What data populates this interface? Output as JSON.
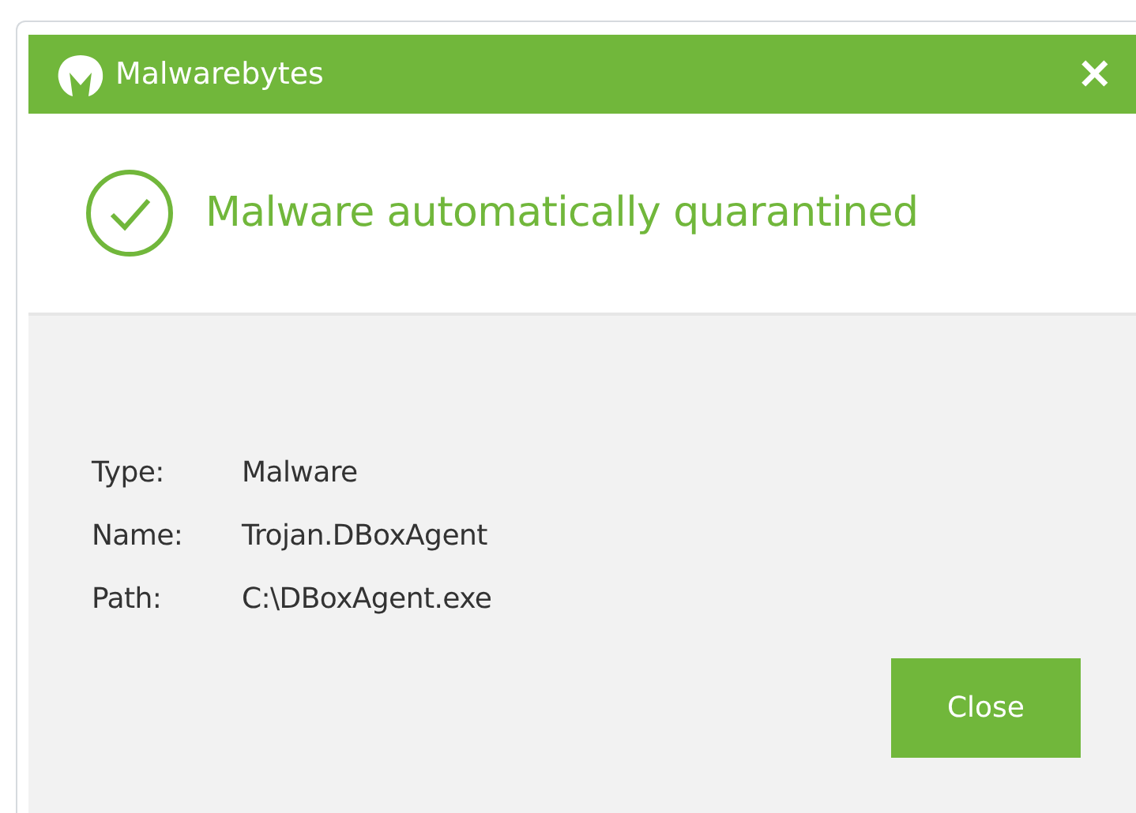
{
  "window": {
    "title": "Malwarebytes",
    "close": "✕"
  },
  "notification": {
    "kind": "success",
    "message": "Malware automatically quarantined"
  },
  "details": [
    {
      "label": "Type:",
      "value": "Malware"
    },
    {
      "label": "Name:",
      "value": "Trojan.DBoxAgent"
    },
    {
      "label": "Path:",
      "value": "C:\\DBoxAgent.exe"
    }
  ],
  "buttons": [
    "Close"
  ]
}
